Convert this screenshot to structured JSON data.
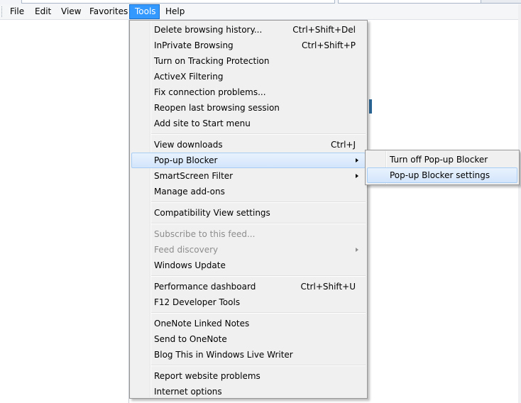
{
  "menubar": {
    "items": [
      {
        "label": "File"
      },
      {
        "label": "Edit"
      },
      {
        "label": "View"
      },
      {
        "label": "Favorites"
      },
      {
        "label": "Tools"
      },
      {
        "label": "Help"
      }
    ],
    "active": "Tools"
  },
  "tools_menu": {
    "items": [
      {
        "label": "Delete browsing history...",
        "shortcut": "Ctrl+Shift+Del"
      },
      {
        "label": "InPrivate Browsing",
        "shortcut": "Ctrl+Shift+P"
      },
      {
        "label": "Turn on Tracking Protection",
        "shortcut": ""
      },
      {
        "label": "ActiveX Filtering",
        "shortcut": ""
      },
      {
        "label": "Fix connection problems...",
        "shortcut": ""
      },
      {
        "label": "Reopen last browsing session",
        "shortcut": ""
      },
      {
        "label": "Add site to Start menu",
        "shortcut": ""
      },
      {
        "label": "View downloads",
        "shortcut": "Ctrl+J"
      },
      {
        "label": "Pop-up Blocker",
        "shortcut": "",
        "submenu": true,
        "highlighted": true
      },
      {
        "label": "SmartScreen Filter",
        "shortcut": "",
        "submenu": true
      },
      {
        "label": "Manage add-ons",
        "shortcut": ""
      },
      {
        "label": "Compatibility View settings",
        "shortcut": ""
      },
      {
        "label": "Subscribe to this feed...",
        "shortcut": "",
        "disabled": true
      },
      {
        "label": "Feed discovery",
        "shortcut": "",
        "submenu": true,
        "disabled": true
      },
      {
        "label": "Windows Update",
        "shortcut": ""
      },
      {
        "label": "Performance dashboard",
        "shortcut": "Ctrl+Shift+U"
      },
      {
        "label": "F12 Developer Tools",
        "shortcut": ""
      },
      {
        "label": "OneNote Linked Notes",
        "shortcut": ""
      },
      {
        "label": "Send to OneNote",
        "shortcut": ""
      },
      {
        "label": "Blog This in Windows Live Writer",
        "shortcut": ""
      },
      {
        "label": "Report website problems",
        "shortcut": ""
      },
      {
        "label": "Internet options",
        "shortcut": ""
      }
    ]
  },
  "popup_blocker_submenu": {
    "items": [
      {
        "label": "Turn off Pop-up Blocker"
      },
      {
        "label": "Pop-up Blocker settings",
        "highlighted": true
      }
    ]
  },
  "colors": {
    "menu_active_bg": "#3399ff",
    "highlight_border": "#a8cdf5",
    "disabled_text": "#8d8d8d",
    "menu_bg": "#f0f0f0"
  }
}
